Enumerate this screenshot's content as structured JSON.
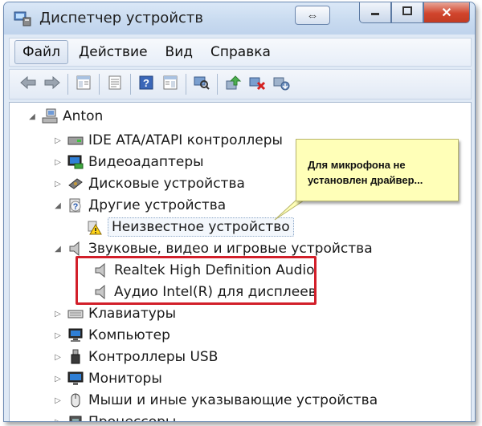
{
  "window": {
    "title": "Диспетчер устройств",
    "close_label": "✕",
    "resize_label": "⇔"
  },
  "menu": [
    {
      "label": "Файл"
    },
    {
      "label": "Действие"
    },
    {
      "label": "Вид"
    },
    {
      "label": "Справка"
    }
  ],
  "toolbar": {
    "icons": [
      "back-arrow-icon",
      "forward-arrow-icon",
      "show-hide-tree-icon",
      "properties-icon",
      "help-icon",
      "action-pane-icon",
      "scan-hardware-icon",
      "update-driver-icon",
      "disable-device-icon",
      "uninstall-device-icon"
    ]
  },
  "tree": {
    "root": "Anton",
    "nodes": [
      {
        "label": "IDE ATA/ATAPI контроллеры",
        "icon": "ide-controller-icon"
      },
      {
        "label": "Видеоадаптеры",
        "icon": "display-adapter-icon"
      },
      {
        "label": "Дисковые устройства",
        "icon": "disk-drive-icon"
      },
      {
        "label": "Другие устройства",
        "icon": "other-devices-icon"
      },
      {
        "label": "Неизвестное устройство",
        "icon": "unknown-device-warning-icon"
      },
      {
        "label": "Звуковые, видео и игровые устройства",
        "icon": "sound-icon"
      },
      {
        "label": "Realtek High Definition Audio",
        "icon": "speaker-icon"
      },
      {
        "label": "Аудио Intel(R) для дисплеев",
        "icon": "speaker-icon"
      },
      {
        "label": "Клавиатуры",
        "icon": "keyboard-icon"
      },
      {
        "label": "Компьютер",
        "icon": "computer-icon"
      },
      {
        "label": "Контроллеры USB",
        "icon": "usb-icon"
      },
      {
        "label": "Мониторы",
        "icon": "monitor-icon"
      },
      {
        "label": "Мыши и иные указывающие устройства",
        "icon": "mouse-icon"
      },
      {
        "label": "Процессоры",
        "icon": "processor-icon"
      }
    ]
  },
  "callout": {
    "text": "Для микрофона не установлен драйвер..."
  },
  "colors": {
    "highlight": "#d21f2a",
    "callout_bg": "#ffffb8"
  }
}
